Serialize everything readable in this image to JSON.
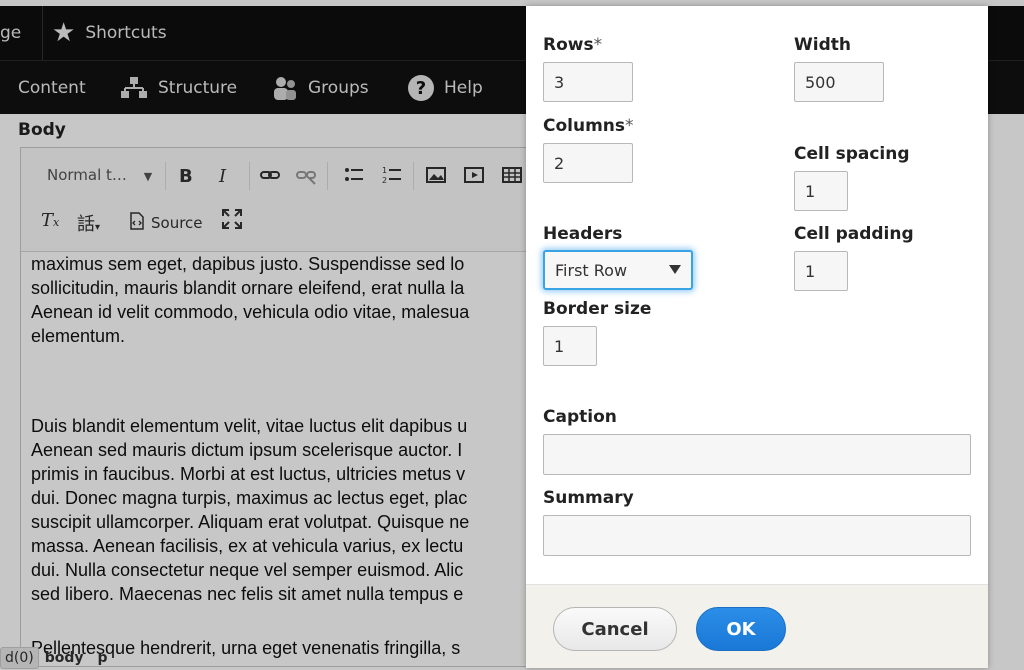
{
  "toolbar": {
    "manage_partial": "ge",
    "shortcuts": "Shortcuts",
    "tray": [
      {
        "label": "Content",
        "icon": "content-icon"
      },
      {
        "label": "Structure",
        "icon": "structure-icon"
      },
      {
        "label": "Groups",
        "icon": "groups-icon"
      },
      {
        "label": "Help",
        "icon": "help-icon"
      }
    ]
  },
  "field": {
    "label": "Body"
  },
  "editor": {
    "format_select": "Normal t…",
    "source_label": "Source",
    "statusbar": {
      "counter": "d(0)",
      "path": [
        "body",
        "p"
      ]
    }
  },
  "content": {
    "p1_lines": [
      "maximus sem eget, dapibus justo. Suspendisse sed lo",
      "sollicitudin, mauris blandit ornare eleifend, erat nulla la",
      "Aenean id velit commodo, vehicula odio vitae, malesua",
      "elementum."
    ],
    "p2_lines": [
      "Duis blandit elementum velit, vitae luctus elit dapibus u",
      "Aenean sed mauris dictum ipsum scelerisque auctor. I",
      "primis in faucibus. Morbi at est luctus, ultricies metus v",
      "dui. Donec magna turpis, maximus ac lectus eget, plac",
      "suscipit ullamcorper. Aliquam erat volutpat. Quisque ne",
      "massa. Aenean facilisis, ex at vehicula varius, ex lectu",
      "dui. Nulla consectetur neque vel semper euismod. Alic",
      "sed libero. Maecenas nec felis sit amet nulla tempus e"
    ],
    "p3_line": "Pellentesque hendrerit, urna eget venenatis fringilla, s"
  },
  "dialog": {
    "rows": {
      "label": "Rows",
      "required_mark": "*",
      "value": "3"
    },
    "columns": {
      "label": "Columns",
      "required_mark": "*",
      "value": "2"
    },
    "headers": {
      "label": "Headers",
      "value": "First Row"
    },
    "border_size": {
      "label": "Border size",
      "value": "1"
    },
    "width": {
      "label": "Width",
      "value": "500"
    },
    "cell_spacing": {
      "label": "Cell spacing",
      "value": "1"
    },
    "cell_padding": {
      "label": "Cell padding",
      "value": "1"
    },
    "caption": {
      "label": "Caption",
      "value": ""
    },
    "summary": {
      "label": "Summary",
      "value": ""
    },
    "cancel_label": "Cancel",
    "ok_label": "OK"
  },
  "colors": {
    "accent": "#1a78d6",
    "focus_ring": "#3aa3e3",
    "toolbar_bg": "#0f0f0f"
  }
}
